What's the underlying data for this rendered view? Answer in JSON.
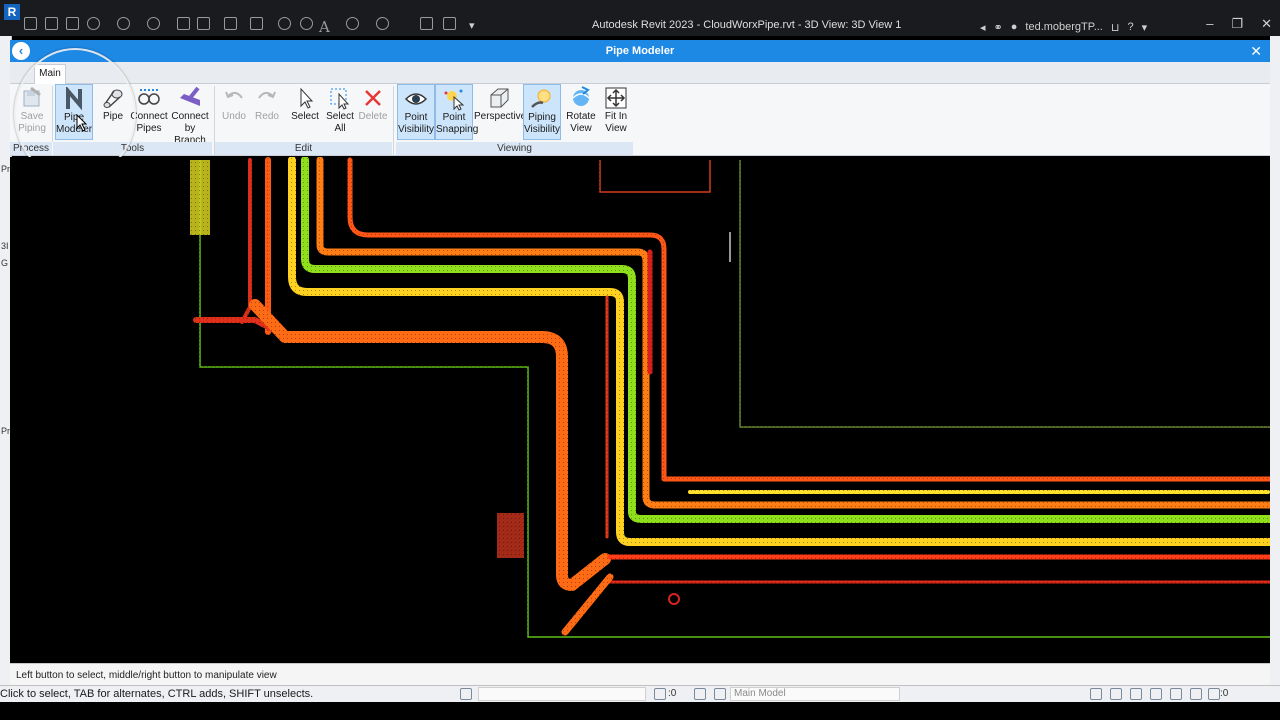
{
  "app": {
    "title": "Autodesk Revit 2023 - CloudWorxPipe.rvt - 3D View: 3D View 1",
    "logo_letter": "R",
    "user": "ted.mobergTP...",
    "help": "?"
  },
  "dialog": {
    "title": "Pipe Modeler",
    "tab": "Main",
    "status": "Left button to select, middle/right button to manipulate view"
  },
  "ribbon": {
    "groups": [
      "Process",
      "Tools",
      "Edit",
      "Viewing"
    ],
    "buttons": [
      {
        "l1": "Save",
        "l2": "Piping"
      },
      {
        "l1": "Pipe",
        "l2": "Modeler"
      },
      {
        "l1": "Pipe",
        "l2": ""
      },
      {
        "l1": "Connect",
        "l2": "Pipes"
      },
      {
        "l1": "Connect",
        "l2": "by Branch"
      },
      {
        "l1": "Undo",
        "l2": ""
      },
      {
        "l1": "Redo",
        "l2": ""
      },
      {
        "l1": "Select",
        "l2": ""
      },
      {
        "l1": "Select",
        "l2": "All"
      },
      {
        "l1": "Delete",
        "l2": ""
      },
      {
        "l1": "Point",
        "l2": "Visibility"
      },
      {
        "l1": "Point",
        "l2": "Snapping"
      },
      {
        "l1": "Perspective",
        "l2": ""
      },
      {
        "l1": "Piping",
        "l2": "Visibility"
      },
      {
        "l1": "Rotate",
        "l2": "View"
      },
      {
        "l1": "Fit In",
        "l2": "View"
      }
    ]
  },
  "statusbar": {
    "hint": "Click to select, TAB for alternates, CTRL adds, SHIFT unselects.",
    "model": "Main Model",
    "count_a": ":0",
    "count_b": ":0"
  },
  "colors": {
    "accent": "#1e88e5",
    "point_red": "#e3241b",
    "point_orange": "#ff7a12",
    "point_yellow": "#ffe02a",
    "point_green": "#8ee01c"
  }
}
